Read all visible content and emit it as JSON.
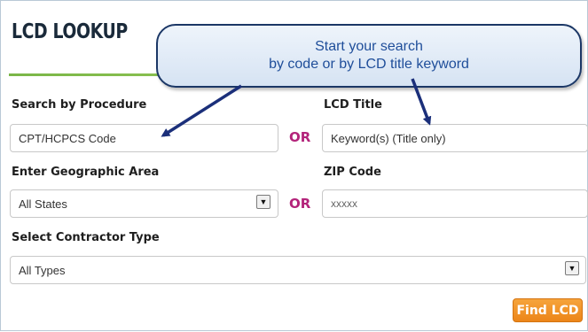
{
  "title": "LCD LOOKUP",
  "callout": {
    "line1": "Start your search",
    "line2": "by code or by LCD title keyword"
  },
  "procedure": {
    "label": "Search by Procedure",
    "value": "CPT/HCPCS Code"
  },
  "or1": "OR",
  "lcd_title": {
    "label": "LCD Title",
    "value": "Keyword(s) (Title only)"
  },
  "geo": {
    "label": "Enter Geographic Area",
    "value": "All States"
  },
  "or2": "OR",
  "zip": {
    "label": "ZIP Code",
    "value": "xxxxx"
  },
  "contractor": {
    "label": "Select Contractor Type",
    "value": "All Types"
  },
  "find_button": "Find LCD",
  "colors": {
    "or": "#b3237a",
    "button": "#ec8519",
    "rule": "#7ab648",
    "callout_text": "#1f4e9a",
    "arrow": "#1b2f7a"
  },
  "icons": {
    "dropdown": "chevron-down-icon"
  }
}
